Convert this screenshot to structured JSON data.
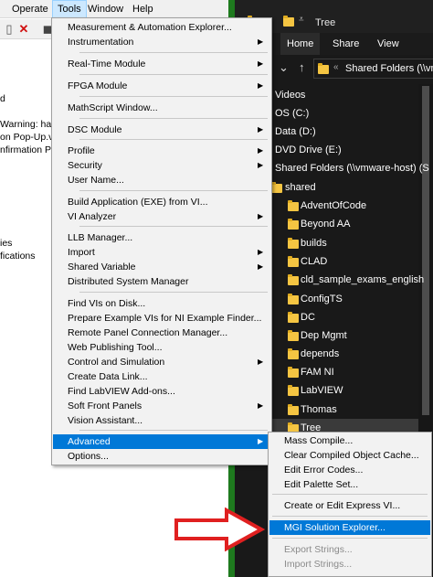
{
  "labview": {
    "menubar": [
      "Operate",
      "Tools",
      "Window",
      "Help"
    ],
    "content_fragments": [
      "d",
      "Warning:  has",
      "on Pop-Up.vi",
      "nfirmation P",
      "ies",
      "fications"
    ]
  },
  "explorer": {
    "title": "Tree",
    "ribbon_tabs": [
      "Home",
      "Share",
      "View"
    ],
    "address": "Shared Folders (\\\\vm",
    "nav_items": [
      {
        "label": "Videos",
        "icon": "videos-icon"
      },
      {
        "label": "OS (C:)",
        "icon": "drive-icon"
      },
      {
        "label": "Data (D:)",
        "icon": "drive-icon"
      },
      {
        "label": "DVD Drive (E:)",
        "icon": "dvd-drive-icon"
      },
      {
        "label": "Shared Folders (\\\\vmware-host) (S",
        "icon": "network-drive-icon"
      },
      {
        "label": "shared",
        "icon": "folder-icon"
      },
      {
        "label": "AdventOfCode",
        "icon": "folder-icon"
      },
      {
        "label": "Beyond AA",
        "icon": "folder-icon"
      },
      {
        "label": "builds",
        "icon": "folder-icon"
      },
      {
        "label": "CLAD",
        "icon": "folder-icon"
      },
      {
        "label": "cld_sample_exams_english",
        "icon": "folder-icon"
      },
      {
        "label": "ConfigTS",
        "icon": "folder-icon"
      },
      {
        "label": "DC",
        "icon": "folder-icon"
      },
      {
        "label": "Dep Mgmt",
        "icon": "folder-icon"
      },
      {
        "label": "depends",
        "icon": "folder-icon"
      },
      {
        "label": "FAM NI",
        "icon": "folder-icon"
      },
      {
        "label": "LabVIEW",
        "icon": "folder-icon"
      },
      {
        "label": "Thomas",
        "icon": "folder-icon"
      },
      {
        "label": "Tree",
        "icon": "folder-icon",
        "selected": true
      }
    ]
  },
  "tools_menu": {
    "items": [
      {
        "label": "Measurement & Automation Explorer...",
        "submenu": false
      },
      {
        "label": "Instrumentation",
        "submenu": true
      },
      {
        "label": "Real-Time Module",
        "submenu": true
      },
      {
        "label": "FPGA Module",
        "submenu": true
      },
      {
        "label": "MathScript Window...",
        "submenu": false
      },
      {
        "label": "DSC Module",
        "submenu": true
      },
      {
        "label": "Profile",
        "submenu": true
      },
      {
        "label": "Security",
        "submenu": true
      },
      {
        "label": "User Name...",
        "submenu": false
      },
      {
        "label": "Build Application (EXE) from VI...",
        "submenu": false
      },
      {
        "label": "VI Analyzer",
        "submenu": true
      },
      {
        "label": "LLB Manager...",
        "submenu": false
      },
      {
        "label": "Import",
        "submenu": true
      },
      {
        "label": "Shared Variable",
        "submenu": true
      },
      {
        "label": "Distributed System Manager",
        "submenu": false
      },
      {
        "label": "Find VIs on Disk...",
        "submenu": false
      },
      {
        "label": "Prepare Example VIs for NI Example Finder...",
        "submenu": false
      },
      {
        "label": "Remote Panel Connection Manager...",
        "submenu": false
      },
      {
        "label": "Web Publishing Tool...",
        "submenu": false
      },
      {
        "label": "Control and Simulation",
        "submenu": true
      },
      {
        "label": "Create Data Link...",
        "submenu": false
      },
      {
        "label": "Find LabVIEW Add-ons...",
        "submenu": false
      },
      {
        "label": "Soft Front Panels",
        "submenu": true
      },
      {
        "label": "Vision Assistant...",
        "submenu": false
      },
      {
        "label": "Advanced",
        "submenu": true,
        "highlighted": true
      },
      {
        "label": "Options...",
        "submenu": false
      }
    ]
  },
  "advanced_submenu": {
    "items": [
      {
        "label": "Mass Compile...",
        "enabled": true
      },
      {
        "label": "Clear Compiled Object Cache...",
        "enabled": true
      },
      {
        "label": "Edit Error Codes...",
        "enabled": true
      },
      {
        "label": "Edit Palette Set...",
        "enabled": true
      },
      {
        "label": "Create or Edit Express VI...",
        "enabled": true
      },
      {
        "label": "MGI Solution Explorer...",
        "enabled": true,
        "highlighted": true
      },
      {
        "label": "Export Strings...",
        "enabled": false
      },
      {
        "label": "Import Strings...",
        "enabled": false
      }
    ]
  },
  "colors": {
    "highlight": "#0078d7",
    "annotation_arrow": "#e02020",
    "folder": "#f5c542"
  }
}
